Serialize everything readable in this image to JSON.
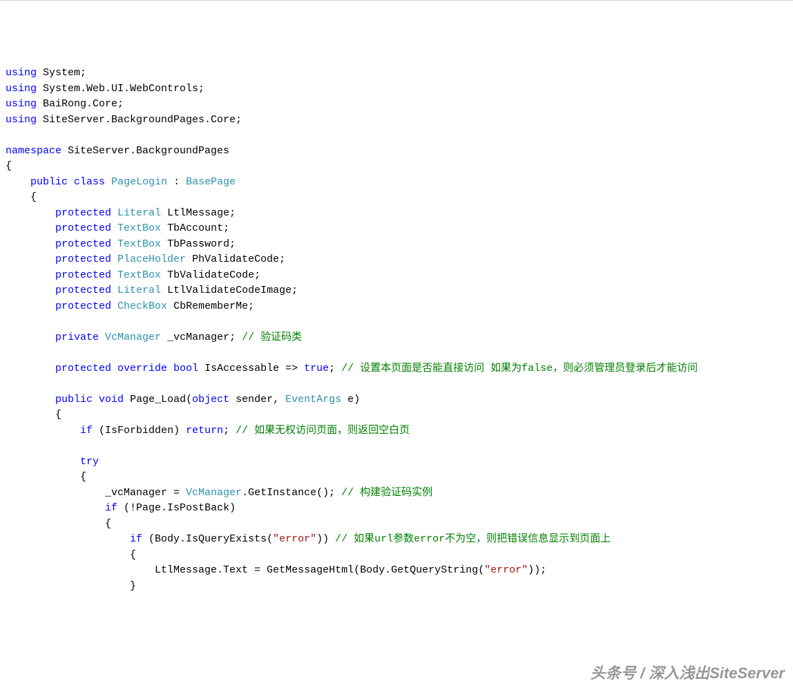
{
  "code": {
    "lines": [
      {
        "segments": [
          {
            "t": "using",
            "c": "kw"
          },
          {
            "t": " System;"
          }
        ]
      },
      {
        "segments": [
          {
            "t": "using",
            "c": "kw"
          },
          {
            "t": " System.Web.UI.WebControls;"
          }
        ]
      },
      {
        "segments": [
          {
            "t": "using",
            "c": "kw"
          },
          {
            "t": " BaiRong.Core;"
          }
        ]
      },
      {
        "segments": [
          {
            "t": "using",
            "c": "kw"
          },
          {
            "t": " SiteServer.BackgroundPages.Core;"
          }
        ]
      },
      {
        "segments": []
      },
      {
        "segments": [
          {
            "t": "namespace",
            "c": "kw"
          },
          {
            "t": " SiteServer.BackgroundPages"
          }
        ]
      },
      {
        "segments": [
          {
            "t": "{"
          }
        ]
      },
      {
        "segments": [
          {
            "t": "    "
          },
          {
            "t": "public",
            "c": "kw"
          },
          {
            "t": " "
          },
          {
            "t": "class",
            "c": "kw"
          },
          {
            "t": " "
          },
          {
            "t": "PageLogin",
            "c": "type"
          },
          {
            "t": " : "
          },
          {
            "t": "BasePage",
            "c": "type"
          }
        ]
      },
      {
        "segments": [
          {
            "t": "    {"
          }
        ]
      },
      {
        "segments": [
          {
            "t": "        "
          },
          {
            "t": "protected",
            "c": "kw"
          },
          {
            "t": " "
          },
          {
            "t": "Literal",
            "c": "type"
          },
          {
            "t": " LtlMessage;"
          }
        ]
      },
      {
        "segments": [
          {
            "t": "        "
          },
          {
            "t": "protected",
            "c": "kw"
          },
          {
            "t": " "
          },
          {
            "t": "TextBox",
            "c": "type"
          },
          {
            "t": " TbAccount;"
          }
        ]
      },
      {
        "segments": [
          {
            "t": "        "
          },
          {
            "t": "protected",
            "c": "kw"
          },
          {
            "t": " "
          },
          {
            "t": "TextBox",
            "c": "type"
          },
          {
            "t": " TbPassword;"
          }
        ]
      },
      {
        "segments": [
          {
            "t": "        "
          },
          {
            "t": "protected",
            "c": "kw"
          },
          {
            "t": " "
          },
          {
            "t": "PlaceHolder",
            "c": "type"
          },
          {
            "t": " PhValidateCode;"
          }
        ]
      },
      {
        "segments": [
          {
            "t": "        "
          },
          {
            "t": "protected",
            "c": "kw"
          },
          {
            "t": " "
          },
          {
            "t": "TextBox",
            "c": "type"
          },
          {
            "t": " TbValidateCode;"
          }
        ]
      },
      {
        "segments": [
          {
            "t": "        "
          },
          {
            "t": "protected",
            "c": "kw"
          },
          {
            "t": " "
          },
          {
            "t": "Literal",
            "c": "type"
          },
          {
            "t": " LtlValidateCodeImage;"
          }
        ]
      },
      {
        "segments": [
          {
            "t": "        "
          },
          {
            "t": "protected",
            "c": "kw"
          },
          {
            "t": " "
          },
          {
            "t": "CheckBox",
            "c": "type"
          },
          {
            "t": " CbRememberMe;"
          }
        ]
      },
      {
        "segments": []
      },
      {
        "segments": [
          {
            "t": "        "
          },
          {
            "t": "private",
            "c": "kw"
          },
          {
            "t": " "
          },
          {
            "t": "VcManager",
            "c": "type"
          },
          {
            "t": " _vcManager; "
          },
          {
            "t": "// 验证码类",
            "c": "comment"
          }
        ]
      },
      {
        "segments": []
      },
      {
        "segments": [
          {
            "t": "        "
          },
          {
            "t": "protected",
            "c": "kw"
          },
          {
            "t": " "
          },
          {
            "t": "override",
            "c": "kw"
          },
          {
            "t": " "
          },
          {
            "t": "bool",
            "c": "kw"
          },
          {
            "t": " IsAccessable => "
          },
          {
            "t": "true",
            "c": "kw"
          },
          {
            "t": "; "
          },
          {
            "t": "// 设置本页面是否能直接访问 如果为false，则必须管理员登录后才能访问",
            "c": "comment"
          }
        ]
      },
      {
        "segments": []
      },
      {
        "segments": [
          {
            "t": "        "
          },
          {
            "t": "public",
            "c": "kw"
          },
          {
            "t": " "
          },
          {
            "t": "void",
            "c": "kw"
          },
          {
            "t": " Page_Load("
          },
          {
            "t": "object",
            "c": "kw"
          },
          {
            "t": " sender, "
          },
          {
            "t": "EventArgs",
            "c": "type"
          },
          {
            "t": " e)"
          }
        ]
      },
      {
        "segments": [
          {
            "t": "        {"
          }
        ]
      },
      {
        "segments": [
          {
            "t": "            "
          },
          {
            "t": "if",
            "c": "kw"
          },
          {
            "t": " (IsForbidden) "
          },
          {
            "t": "return",
            "c": "kw"
          },
          {
            "t": "; "
          },
          {
            "t": "// 如果无权访问页面，则返回空白页",
            "c": "comment"
          }
        ]
      },
      {
        "segments": []
      },
      {
        "segments": [
          {
            "t": "            "
          },
          {
            "t": "try",
            "c": "kw"
          }
        ]
      },
      {
        "segments": [
          {
            "t": "            {"
          }
        ]
      },
      {
        "segments": [
          {
            "t": "                _vcManager = "
          },
          {
            "t": "VcManager",
            "c": "type"
          },
          {
            "t": ".GetInstance(); "
          },
          {
            "t": "// 构建验证码实例",
            "c": "comment"
          }
        ]
      },
      {
        "segments": [
          {
            "t": "                "
          },
          {
            "t": "if",
            "c": "kw"
          },
          {
            "t": " (!Page.IsPostBack)"
          }
        ]
      },
      {
        "segments": [
          {
            "t": "                {"
          }
        ]
      },
      {
        "segments": [
          {
            "t": "                    "
          },
          {
            "t": "if",
            "c": "kw"
          },
          {
            "t": " (Body.IsQueryExists("
          },
          {
            "t": "\"error\"",
            "c": "str"
          },
          {
            "t": ")) "
          },
          {
            "t": "// 如果url参数error不为空，则把错误信息显示到页面上",
            "c": "comment"
          }
        ]
      },
      {
        "segments": [
          {
            "t": "                    {"
          }
        ]
      },
      {
        "segments": [
          {
            "t": "                        LtlMessage.Text = GetMessageHtml(Body.GetQueryString("
          },
          {
            "t": "\"error\"",
            "c": "str"
          },
          {
            "t": "));"
          }
        ]
      },
      {
        "segments": [
          {
            "t": "                    }"
          }
        ]
      }
    ]
  },
  "watermark": "头条号 / 深入浅出SiteServer"
}
